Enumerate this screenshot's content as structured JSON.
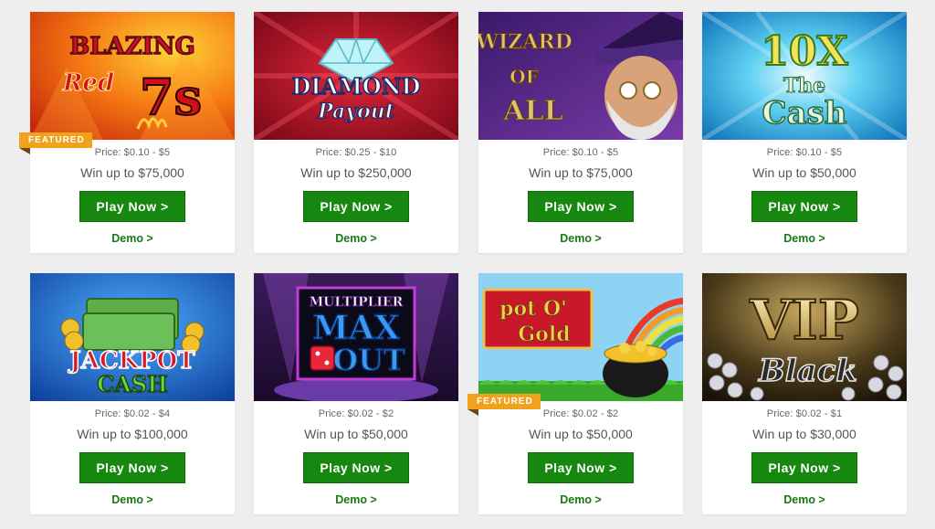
{
  "games": [
    {
      "title_line1": "BLAZING",
      "title_line2": "Red",
      "title_line3": "7s",
      "price": "Price: $0.10 - $5",
      "win": "Win up to $75,000",
      "play_label": "Play Now >",
      "demo_label": "Demo >",
      "badge": "FEATURED"
    },
    {
      "title_line1": "DIAMOND",
      "title_line2": "Payout",
      "price": "Price: $0.25 - $10",
      "win": "Win up to $250,000",
      "play_label": "Play Now >",
      "demo_label": "Demo >"
    },
    {
      "title_line1": "WIZARD",
      "title_line2": "OF",
      "title_line3": "ALL",
      "price": "Price: $0.10 - $5",
      "win": "Win up to $75,000",
      "play_label": "Play Now >",
      "demo_label": "Demo >"
    },
    {
      "title_line1": "10X",
      "title_line2": "The",
      "title_line3": "Cash",
      "price": "Price: $0.10 - $5",
      "win": "Win up to $50,000",
      "play_label": "Play Now >",
      "demo_label": "Demo >"
    },
    {
      "title_line1": "JACKPOT",
      "title_line2": "CASH",
      "price": "Price: $0.02 - $4",
      "win": "Win up to $100,000",
      "play_label": "Play Now >",
      "demo_label": "Demo >"
    },
    {
      "title_line1": "MULTIPLIER",
      "title_line2": "MAX",
      "title_line3": "OUT",
      "price": "Price: $0.02 - $2",
      "win": "Win up to $50,000",
      "play_label": "Play Now >",
      "demo_label": "Demo >"
    },
    {
      "title_line1": "pot O'",
      "title_line2": "Gold",
      "price": "Price: $0.02 - $2",
      "win": "Win up to $50,000",
      "play_label": "Play Now >",
      "demo_label": "Demo >",
      "badge": "FEATURED"
    },
    {
      "title_line1": "VIP",
      "title_line2": "Black",
      "price": "Price: $0.02 - $1",
      "win": "Win up to $30,000",
      "play_label": "Play Now >",
      "demo_label": "Demo >"
    }
  ],
  "colors": {
    "button_green": "#16870f",
    "demo_green": "#1a7a12",
    "featured_orange": "#f0a21c"
  }
}
